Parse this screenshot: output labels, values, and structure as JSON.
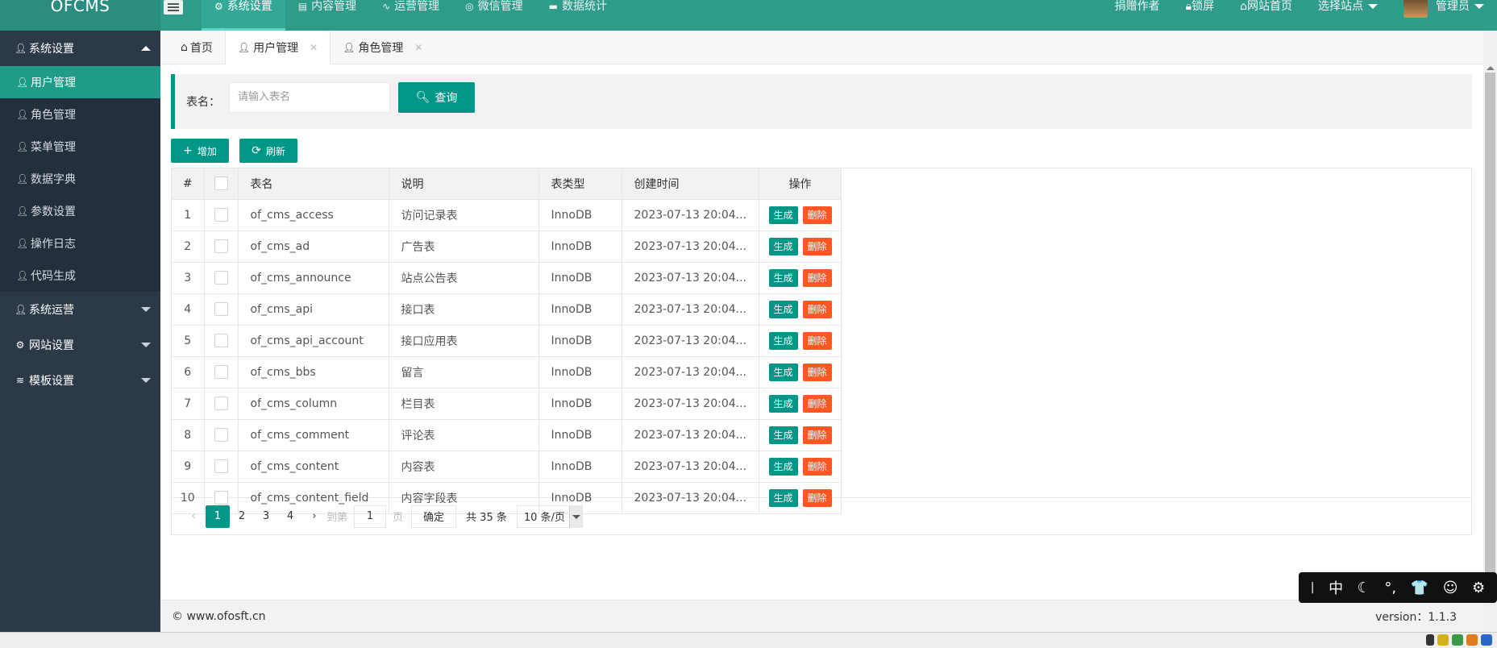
{
  "app": {
    "title": "OFCMS"
  },
  "topnav": [
    {
      "label": "系统设置",
      "icon": "gear-icon",
      "active": true
    },
    {
      "label": "内容管理",
      "icon": "document-icon",
      "active": false
    },
    {
      "label": "运营管理",
      "icon": "pulse-icon",
      "active": false
    },
    {
      "label": "微信管理",
      "icon": "wechat-icon",
      "active": false
    },
    {
      "label": "数据统计",
      "icon": "chart-icon",
      "active": false
    }
  ],
  "topright": {
    "donate": "捐赠作者",
    "lock": "锁屏",
    "home": "网站首页",
    "site": "选择站点",
    "user": "管理员"
  },
  "sidebar": {
    "group1": "系统设置",
    "items": [
      {
        "label": "用户管理",
        "active": true
      },
      {
        "label": "角色管理",
        "active": false
      },
      {
        "label": "菜单管理",
        "active": false
      },
      {
        "label": "数据字典",
        "active": false
      },
      {
        "label": "参数设置",
        "active": false
      },
      {
        "label": "操作日志",
        "active": false
      },
      {
        "label": "代码生成",
        "active": false
      }
    ],
    "group2": "系统运营",
    "group3": "网站设置",
    "group4": "模板设置"
  },
  "tabs": [
    {
      "label": "首页",
      "icon": "home-icon"
    },
    {
      "label": "用户管理",
      "icon": "user-icon",
      "active": true
    },
    {
      "label": "角色管理",
      "icon": "user-icon"
    }
  ],
  "search": {
    "label": "表名：",
    "placeholder": "请输入表名",
    "button": "查询"
  },
  "toolbar": {
    "add": "增加",
    "refresh": "刷新"
  },
  "table": {
    "headers": [
      "#",
      "",
      "表名",
      "说明",
      "表类型",
      "创建时间",
      "操作"
    ],
    "gen_label": "生成",
    "del_label": "删除",
    "rows": [
      {
        "n": "1",
        "name": "of_cms_access",
        "desc": "访问记录表",
        "type": "InnoDB",
        "time": "2023-07-13 20:04..."
      },
      {
        "n": "2",
        "name": "of_cms_ad",
        "desc": "广告表",
        "type": "InnoDB",
        "time": "2023-07-13 20:04..."
      },
      {
        "n": "3",
        "name": "of_cms_announce",
        "desc": "站点公告表",
        "type": "InnoDB",
        "time": "2023-07-13 20:04..."
      },
      {
        "n": "4",
        "name": "of_cms_api",
        "desc": "接口表",
        "type": "InnoDB",
        "time": "2023-07-13 20:04..."
      },
      {
        "n": "5",
        "name": "of_cms_api_account",
        "desc": "接口应用表",
        "type": "InnoDB",
        "time": "2023-07-13 20:04..."
      },
      {
        "n": "6",
        "name": "of_cms_bbs",
        "desc": "留言",
        "type": "InnoDB",
        "time": "2023-07-13 20:04..."
      },
      {
        "n": "7",
        "name": "of_cms_column",
        "desc": "栏目表",
        "type": "InnoDB",
        "time": "2023-07-13 20:04..."
      },
      {
        "n": "8",
        "name": "of_cms_comment",
        "desc": "评论表",
        "type": "InnoDB",
        "time": "2023-07-13 20:04..."
      },
      {
        "n": "9",
        "name": "of_cms_content",
        "desc": "内容表",
        "type": "InnoDB",
        "time": "2023-07-13 20:04..."
      },
      {
        "n": "10",
        "name": "of_cms_content_field",
        "desc": "内容字段表",
        "type": "InnoDB",
        "time": "2023-07-13 20:04..."
      }
    ]
  },
  "pager": {
    "pages": [
      "1",
      "2",
      "3",
      "4"
    ],
    "goto": "到第",
    "goto_value": "1",
    "page_unit": "页",
    "confirm": "确定",
    "total": "共 35 条",
    "per_page": "10 条/页"
  },
  "footer": {
    "left": "© www.ofosft.cn",
    "right": "version：1.1.3"
  },
  "ime": [
    "中",
    "☾",
    "°,",
    "👕",
    "☺",
    "⚙"
  ]
}
